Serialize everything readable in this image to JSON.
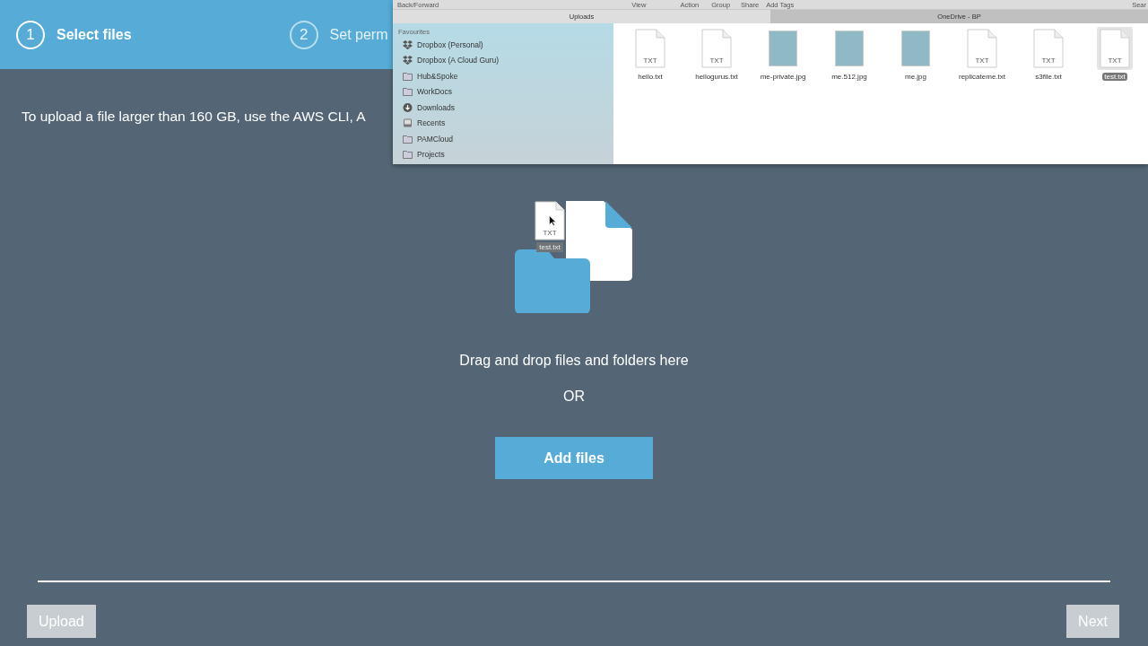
{
  "steps": [
    {
      "number": "1",
      "label": "Select files",
      "selected": true
    },
    {
      "number": "2",
      "label": "Set perm",
      "selected": false
    }
  ],
  "notice": "To upload a file larger than 160 GB, use the AWS CLI, A",
  "dropzone": {
    "text": "Drag and drop files and folders here",
    "or": "OR",
    "button": "Add files"
  },
  "drag_ghost": {
    "badge": "TXT",
    "name": "test.txt"
  },
  "footer": {
    "buttons": [
      {
        "label": "Upload",
        "disabled": true
      },
      {
        "label": "Next",
        "disabled": true
      }
    ]
  },
  "finder": {
    "toolbar": [
      "Back/Forward",
      "View",
      "Action",
      "Group",
      "Share",
      "Add Tags",
      "Sear"
    ],
    "tabs": [
      {
        "label": "Uploads",
        "selected": true
      },
      {
        "label": "OneDrive - BP",
        "selected": false
      }
    ],
    "sidebar": {
      "heading": "Favourites",
      "items": [
        {
          "label": "Dropbox (Personal)",
          "kind": "dropbox"
        },
        {
          "label": "Dropbox (A Cloud Guru)",
          "kind": "dropbox"
        },
        {
          "label": "Hub&Spoke",
          "kind": "folder"
        },
        {
          "label": "WorkDocs",
          "kind": "folder"
        },
        {
          "label": "Downloads",
          "kind": "download"
        },
        {
          "label": "Recents",
          "kind": "recents"
        },
        {
          "label": "PAMCloud",
          "kind": "folder"
        },
        {
          "label": "Projects",
          "kind": "folder"
        }
      ]
    },
    "files": [
      {
        "name": "hello.txt",
        "kind": "text",
        "badge": "TXT",
        "selected": false
      },
      {
        "name": "hellogurus.txt",
        "kind": "text",
        "badge": "TXT",
        "selected": false
      },
      {
        "name": "me-private.jpg",
        "kind": "photo",
        "selected": false
      },
      {
        "name": "me.512.jpg",
        "kind": "photo",
        "selected": false
      },
      {
        "name": "me.jpg",
        "kind": "photo",
        "selected": false
      },
      {
        "name": "replicateme.txt",
        "kind": "text",
        "badge": "TXT",
        "selected": false
      },
      {
        "name": "s3file.txt",
        "kind": "text",
        "badge": "TXT",
        "selected": false
      },
      {
        "name": "test.txt",
        "kind": "text",
        "badge": "TXT",
        "selected": true
      }
    ]
  }
}
